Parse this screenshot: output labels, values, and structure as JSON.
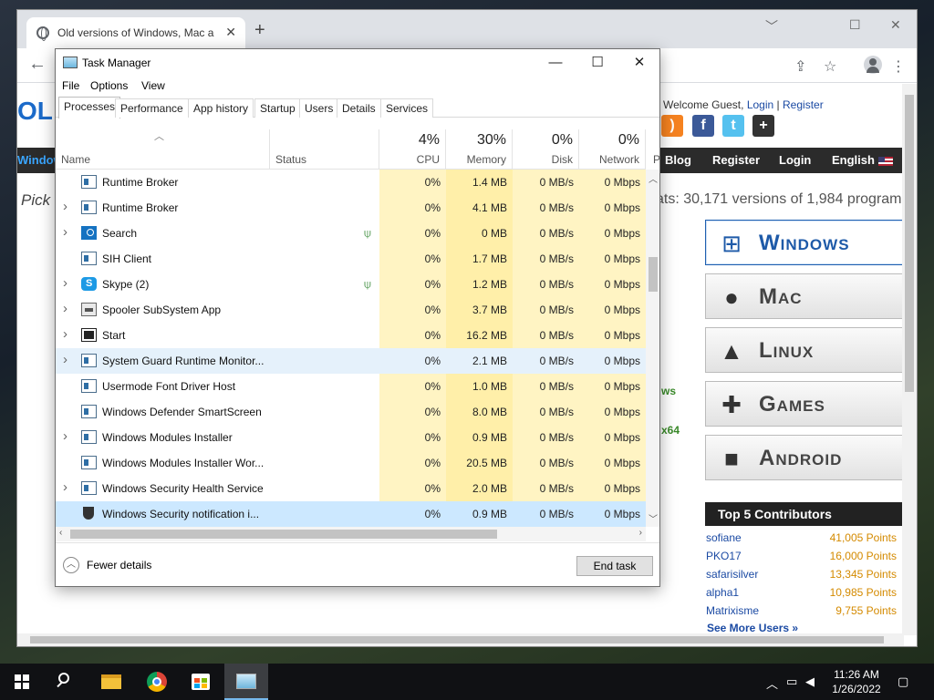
{
  "browser": {
    "tab_title": "Old versions of Windows, Mac a",
    "tab_close": "✕",
    "new_tab": "+",
    "minimize": "﹀",
    "restore": "☐",
    "close": "✕"
  },
  "website": {
    "logo_fragment": "OL",
    "welcome": "Welcome Guest,",
    "login_link": "Login",
    "separator": "|",
    "register_link": "Register",
    "nav_left": "Window",
    "nav_items": [
      "Blog",
      "Register",
      "Login",
      "English"
    ],
    "pick_text": "Pick",
    "stats": "ats: 30,171 versions of 1,984 program",
    "os_buttons": [
      {
        "label": "Windows",
        "icon": "windows-icon"
      },
      {
        "label": "Mac",
        "icon": "apple-icon"
      },
      {
        "label": "Linux",
        "icon": "linux-icon"
      },
      {
        "label": "Games",
        "icon": "gamepad-icon"
      },
      {
        "label": "Android",
        "icon": "android-icon"
      }
    ],
    "side_fragments": [
      "ws",
      "x64"
    ],
    "contributors_title": "Top 5 Contributors",
    "contributors": [
      {
        "name": "sofiane",
        "points": "41,005 Points"
      },
      {
        "name": "PKO17",
        "points": "16,000 Points"
      },
      {
        "name": "safarisilver",
        "points": "13,345 Points"
      },
      {
        "name": "alpha1",
        "points": "10,985 Points"
      },
      {
        "name": "Matrixisme",
        "points": "9,755 Points"
      }
    ],
    "see_more": "See More Users »"
  },
  "task_manager": {
    "title": "Task Manager",
    "menu": [
      "File",
      "Options",
      "View"
    ],
    "tabs": [
      "Processes",
      "Performance",
      "App history",
      "Startup",
      "Users",
      "Details",
      "Services"
    ],
    "selected_tab": "Processes",
    "columns": {
      "name": "Name",
      "status": "Status",
      "cpu": {
        "pct": "4%",
        "label": "CPU"
      },
      "memory": {
        "pct": "30%",
        "label": "Memory"
      },
      "disk": {
        "pct": "0%",
        "label": "Disk"
      },
      "network": {
        "pct": "0%",
        "label": "Network"
      },
      "power": "P"
    },
    "processes": [
      {
        "name": "Runtime Broker",
        "expand": false,
        "icon": "app",
        "leaf": false,
        "cpu": "0%",
        "memory": "1.4 MB",
        "disk": "0 MB/s",
        "network": "0 Mbps"
      },
      {
        "name": "Runtime Broker",
        "expand": true,
        "icon": "app",
        "leaf": false,
        "cpu": "0%",
        "memory": "4.1 MB",
        "disk": "0 MB/s",
        "network": "0 Mbps"
      },
      {
        "name": "Search",
        "expand": true,
        "icon": "search",
        "leaf": true,
        "cpu": "0%",
        "memory": "0 MB",
        "disk": "0 MB/s",
        "network": "0 Mbps"
      },
      {
        "name": "SIH Client",
        "expand": false,
        "icon": "app",
        "leaf": false,
        "cpu": "0%",
        "memory": "1.7 MB",
        "disk": "0 MB/s",
        "network": "0 Mbps"
      },
      {
        "name": "Skype (2)",
        "expand": true,
        "icon": "skype",
        "leaf": true,
        "cpu": "0%",
        "memory": "1.2 MB",
        "disk": "0 MB/s",
        "network": "0 Mbps"
      },
      {
        "name": "Spooler SubSystem App",
        "expand": true,
        "icon": "printer",
        "leaf": false,
        "cpu": "0%",
        "memory": "3.7 MB",
        "disk": "0 MB/s",
        "network": "0 Mbps"
      },
      {
        "name": "Start",
        "expand": true,
        "icon": "start",
        "leaf": false,
        "cpu": "0%",
        "memory": "16.2 MB",
        "disk": "0 MB/s",
        "network": "0 Mbps"
      },
      {
        "name": "System Guard Runtime Monitor...",
        "expand": true,
        "icon": "app",
        "leaf": false,
        "cpu": "0%",
        "memory": "2.1 MB",
        "disk": "0 MB/s",
        "network": "0 Mbps"
      },
      {
        "name": "Usermode Font Driver Host",
        "expand": false,
        "icon": "app",
        "leaf": false,
        "cpu": "0%",
        "memory": "1.0 MB",
        "disk": "0 MB/s",
        "network": "0 Mbps"
      },
      {
        "name": "Windows Defender SmartScreen",
        "expand": false,
        "icon": "app",
        "leaf": false,
        "cpu": "0%",
        "memory": "8.0 MB",
        "disk": "0 MB/s",
        "network": "0 Mbps"
      },
      {
        "name": "Windows Modules Installer",
        "expand": true,
        "icon": "app",
        "leaf": false,
        "cpu": "0%",
        "memory": "0.9 MB",
        "disk": "0 MB/s",
        "network": "0 Mbps"
      },
      {
        "name": "Windows Modules Installer Wor...",
        "expand": false,
        "icon": "app",
        "leaf": false,
        "cpu": "0%",
        "memory": "20.5 MB",
        "disk": "0 MB/s",
        "network": "0 Mbps"
      },
      {
        "name": "Windows Security Health Service",
        "expand": true,
        "icon": "app",
        "leaf": false,
        "cpu": "0%",
        "memory": "2.0 MB",
        "disk": "0 MB/s",
        "network": "0 Mbps"
      },
      {
        "name": "Windows Security notification i...",
        "expand": false,
        "icon": "shield",
        "leaf": false,
        "cpu": "0%",
        "memory": "0.9 MB",
        "disk": "0 MB/s",
        "network": "0 Mbps"
      }
    ],
    "fewer_details": "Fewer details",
    "end_task": "End task"
  },
  "taskbar": {
    "time": "11:26 AM",
    "date": "1/26/2022",
    "pinned": [
      "start-button",
      "search-icon",
      "file-explorer-icon",
      "chrome-icon",
      "store-icon",
      "task-manager-icon"
    ]
  }
}
